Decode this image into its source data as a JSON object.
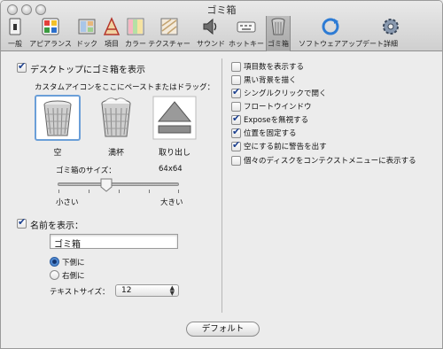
{
  "window": {
    "title": "ゴミ箱"
  },
  "toolbar": {
    "items": [
      {
        "label": "一般",
        "icon": "switch-icon"
      },
      {
        "label": "アピアランス",
        "icon": "appearance-icon"
      },
      {
        "label": "ドック",
        "icon": "dock-icon"
      },
      {
        "label": "項目",
        "icon": "items-icon"
      },
      {
        "label": "カラー",
        "icon": "color-icon"
      },
      {
        "label": "テクスチャー",
        "icon": "texture-icon"
      },
      {
        "label": "サウンド",
        "icon": "sound-icon"
      },
      {
        "label": "ホットキー",
        "icon": "keyboard-icon"
      },
      {
        "label": "ゴミ箱",
        "icon": "trash-icon"
      },
      {
        "label": "ソフトウェアアップデート",
        "icon": "update-icon"
      },
      {
        "label": "詳細",
        "icon": "gear-icon"
      }
    ],
    "selected": "ゴミ箱"
  },
  "left": {
    "show_on_desktop": {
      "label": "デスクトップにゴミ箱を表示",
      "checked": true
    },
    "paste_hint": "カスタムアイコンをここにペーストまたはドラッグ：",
    "icons": [
      {
        "label": "空",
        "selected": true
      },
      {
        "label": "満杯",
        "selected": false
      },
      {
        "label": "取り出し",
        "selected": false
      }
    ],
    "size": {
      "label": "ゴミ箱のサイズ：",
      "value": "64x64",
      "min_label": "小さい",
      "max_label": "大きい",
      "fraction": 0.4
    },
    "show_name": {
      "label": "名前を表示：",
      "checked": true
    },
    "name_value": "ゴミ箱",
    "position": {
      "below": "下側に",
      "right": "右側に",
      "selected": "下側に"
    },
    "text_size": {
      "label": "テキストサイズ：",
      "value": "12"
    }
  },
  "right": {
    "options": [
      {
        "label": "項目数を表示する",
        "checked": false
      },
      {
        "label": "黒い背景を描く",
        "checked": false
      },
      {
        "label": "シングルクリックで開く",
        "checked": true
      },
      {
        "label": "フロートウインドウ",
        "checked": false
      },
      {
        "label": "Exposeを無視する",
        "checked": true
      },
      {
        "label": "位置を固定する",
        "checked": true
      },
      {
        "label": "空にする前に警告を出す",
        "checked": true
      },
      {
        "label": "個々のディスクをコンテクストメニューに表示する",
        "checked": false
      }
    ]
  },
  "footer": {
    "default_button": "デフォルト"
  },
  "colors": {
    "accent": "#2a6bc3",
    "check": "#1b3f8e"
  }
}
